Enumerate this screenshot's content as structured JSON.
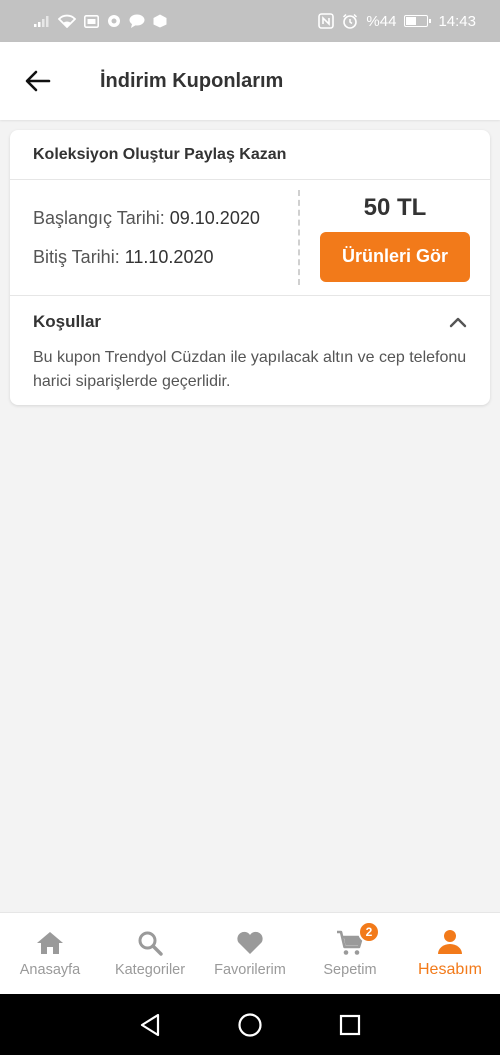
{
  "status_bar": {
    "battery_text": "%44",
    "time": "14:43",
    "battery_level": 0.44
  },
  "header": {
    "title": "İndirim Kuponlarım"
  },
  "coupon": {
    "title": "Koleksiyon Oluştur Paylaş Kazan",
    "start_label": "Başlangıç Tarihi:",
    "start_date": "09.10.2020",
    "end_label": "Bitiş Tarihi:",
    "end_date": "11.10.2020",
    "amount": "50 TL",
    "button_label": "Ürünleri Gör",
    "conditions_label": "Koşullar",
    "conditions_text": "Bu kupon Trendyol Cüzdan ile yapılacak altın ve cep telefonu harici siparişlerde geçerlidir."
  },
  "bottom_nav": {
    "items": [
      {
        "label": "Anasayfa",
        "icon": "home-icon"
      },
      {
        "label": "Kategoriler",
        "icon": "search-icon"
      },
      {
        "label": "Favorilerim",
        "icon": "heart-icon"
      },
      {
        "label": "Sepetim",
        "icon": "cart-icon",
        "badge": "2"
      },
      {
        "label": "Hesabım",
        "icon": "person-icon",
        "active": true
      }
    ]
  },
  "colors": {
    "accent": "#f27a1a",
    "status_bar": "#c2c2c2",
    "background": "#f3f3f3",
    "inactive_nav": "#9a9a9a"
  }
}
